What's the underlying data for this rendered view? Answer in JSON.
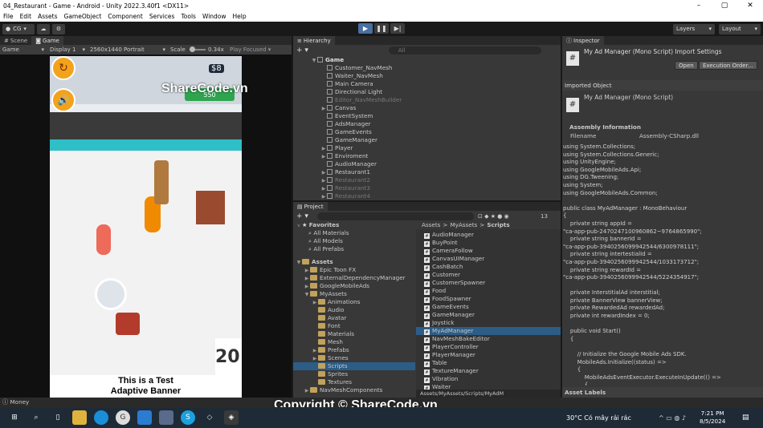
{
  "window": {
    "title": "04_Restaurant - Game - Android - Unity 2022.3.40f1 <DX11>"
  },
  "menu": [
    "File",
    "Edit",
    "Assets",
    "GameObject",
    "Component",
    "Services",
    "Tools",
    "Window",
    "Help"
  ],
  "toolbar": {
    "account": "CG",
    "layers": "Layers",
    "layout": "Layout"
  },
  "scene_tabs": {
    "scene": "Scene",
    "game": "Game"
  },
  "game_bar": {
    "mode": "Game",
    "display": "Display 1",
    "resolution": "2560x1440 Portrait",
    "scale_label": "Scale",
    "scale_value": "0.34x",
    "play_focused": "Play Focused"
  },
  "game_view": {
    "coins": "550",
    "currency": "$8",
    "banner_line1": "This is a Test",
    "banner_line2": "Adaptive Banner",
    "counter": "20"
  },
  "watermark": "ShareCode.vn",
  "hierarchy": {
    "title": "Hierarchy",
    "search_placeholder": "All",
    "items": [
      {
        "label": "Game",
        "level": 0,
        "exp": "v",
        "dim": false,
        "bold": true
      },
      {
        "label": "Customer_NavMesh",
        "level": 1,
        "exp": "",
        "dim": false
      },
      {
        "label": "Waiter_NavMesh",
        "level": 1,
        "exp": "",
        "dim": false
      },
      {
        "label": "Main Camera",
        "level": 1,
        "exp": "",
        "dim": false
      },
      {
        "label": "Directional Light",
        "level": 1,
        "exp": "",
        "dim": false
      },
      {
        "label": "Editor_NavMeshBuilder",
        "level": 1,
        "exp": "",
        "dim": true
      },
      {
        "label": "Canvas",
        "level": 1,
        "exp": ">",
        "dim": false
      },
      {
        "label": "EventSystem",
        "level": 1,
        "exp": "",
        "dim": false
      },
      {
        "label": "AdsManager",
        "level": 1,
        "exp": "",
        "dim": false
      },
      {
        "label": "GameEvents",
        "level": 1,
        "exp": "",
        "dim": false
      },
      {
        "label": "GameManager",
        "level": 1,
        "exp": "",
        "dim": false
      },
      {
        "label": "Player",
        "level": 1,
        "exp": ">",
        "dim": false
      },
      {
        "label": "Enviroment",
        "level": 1,
        "exp": ">",
        "dim": false
      },
      {
        "label": "AudioManager",
        "level": 1,
        "exp": "",
        "dim": false
      },
      {
        "label": "Restaurant1",
        "level": 1,
        "exp": ">",
        "dim": false
      },
      {
        "label": "Restaurant2",
        "level": 1,
        "exp": ">",
        "dim": true
      },
      {
        "label": "Restaurant3",
        "level": 1,
        "exp": ">",
        "dim": true
      },
      {
        "label": "Restaurant4",
        "level": 1,
        "exp": ">",
        "dim": true
      }
    ]
  },
  "project": {
    "title": "Project",
    "count": "13",
    "favorites": {
      "label": "Favorites",
      "items": [
        "All Materials",
        "All Models",
        "All Prefabs"
      ]
    },
    "tree": [
      {
        "label": "Assets",
        "level": 0,
        "bold": true,
        "exp": "v"
      },
      {
        "label": "Epic Toon FX",
        "level": 1,
        "exp": ">"
      },
      {
        "label": "ExternalDependencyManager",
        "level": 1,
        "exp": ">"
      },
      {
        "label": "GoogleMobileAds",
        "level": 1,
        "exp": ">"
      },
      {
        "label": "MyAssets",
        "level": 1,
        "exp": "v"
      },
      {
        "label": "Animations",
        "level": 2,
        "exp": ">"
      },
      {
        "label": "Audio",
        "level": 2,
        "exp": ""
      },
      {
        "label": "Avatar",
        "level": 2,
        "exp": ""
      },
      {
        "label": "Font",
        "level": 2,
        "exp": ""
      },
      {
        "label": "Materials",
        "level": 2,
        "exp": ""
      },
      {
        "label": "Mesh",
        "level": 2,
        "exp": ""
      },
      {
        "label": "Prefabs",
        "level": 2,
        "exp": ">"
      },
      {
        "label": "Scenes",
        "level": 2,
        "exp": ">"
      },
      {
        "label": "Scripts",
        "level": 2,
        "exp": "",
        "sel": true
      },
      {
        "label": "Sprites",
        "level": 2,
        "exp": ""
      },
      {
        "label": "Textures",
        "level": 2,
        "exp": ""
      },
      {
        "label": "NavMeshComponents",
        "level": 1,
        "exp": ">"
      }
    ],
    "breadcrumb": [
      "Assets",
      ">",
      "MyAssets",
      ">",
      "Scripts"
    ],
    "files": [
      "AudioManager",
      "BuyPoint",
      "CameraFollow",
      "CanvasUIManager",
      "CashBatch",
      "Customer",
      "CustomerSpawner",
      "Food",
      "FoodSpawner",
      "GameEvents",
      "GameManager",
      "Joystick",
      "MyAdManager",
      "NavMeshBakeEditor",
      "PlayerController",
      "PlayerManager",
      "Table",
      "TextureManager",
      "Vibration",
      "Waiter"
    ],
    "selected_file": "MyAdManager",
    "path": "Assets/MyAssets/Scripts/MyAdM"
  },
  "inspector": {
    "title": "Inspector",
    "header": "My Ad Manager (Mono Script) Import Settings",
    "open_btn": "Open",
    "exec_btn": "Execution Order...",
    "imported_label": "Imported Object",
    "imported_name": "My Ad Manager (Mono Script)",
    "assembly_title": "Assembly Information",
    "filename_label": "Filename",
    "filename_value": "Assembly-CSharp.dll",
    "code": [
      "using System.Collections;",
      "using System.Collections.Generic;",
      "using UnityEngine;",
      "using GoogleMobileAds.Api;",
      "using DG.Tweening;",
      "using System;",
      "using GoogleMobileAds.Common;",
      "",
      "public class MyAdManager : MonoBehaviour",
      "{",
      "    private string appId =",
      "\"ca-app-pub-2470247100960862~9764865990\";",
      "    private string bannerId =",
      "\"ca-app-pub-3940256099942544/6300978111\";",
      "    private string intertestialId =",
      "\"ca-app-pub-3940256099942544/1033173712\";",
      "    private string rewardId =",
      "\"ca-app-pub-3940256099942544/5224354917\";",
      "",
      "    private InterstitialAd interstitial;",
      "    private BannerView bannerView;",
      "    private RewardedAd rewardedAd;",
      "    private int rewardIndex = 0;",
      "",
      "    public void Start()",
      "    {",
      "",
      "        // Initialize the Google Mobile Ads SDK.",
      "        MobileAds.Initialize((status) =>",
      "        {",
      "            MobileAdsEventExecutor.ExecuteInUpdate(() =>",
      "            {"
    ],
    "asset_labels": "Asset Labels"
  },
  "status": {
    "text": "Money"
  },
  "copyright": "Copyright © ShareCode.vn",
  "taskbar": {
    "weather": "30°C  Có mây rải rác",
    "time": "7:21 PM",
    "date": "8/5/2024"
  }
}
